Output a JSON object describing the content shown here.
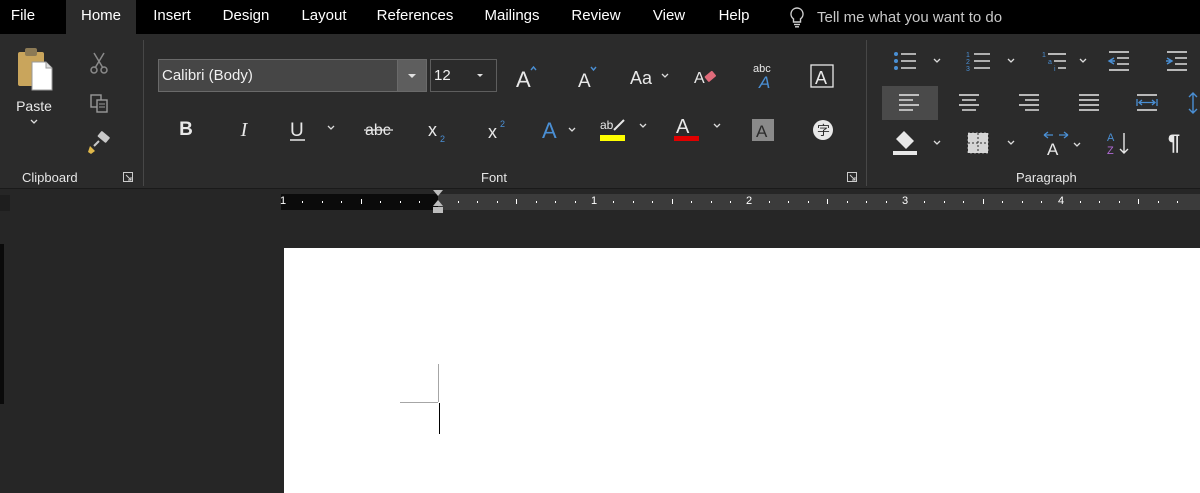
{
  "tabs": [
    {
      "label": "File",
      "active": false
    },
    {
      "label": "Home",
      "active": true
    },
    {
      "label": "Insert",
      "active": false
    },
    {
      "label": "Design",
      "active": false
    },
    {
      "label": "Layout",
      "active": false
    },
    {
      "label": "References",
      "active": false
    },
    {
      "label": "Mailings",
      "active": false
    },
    {
      "label": "Review",
      "active": false
    },
    {
      "label": "View",
      "active": false
    },
    {
      "label": "Help",
      "active": false
    }
  ],
  "tell_me": {
    "placeholder": "Tell me what you want to do",
    "icon": "lightbulb-icon"
  },
  "clipboard": {
    "paste_label": "Paste",
    "group_label": "Clipboard"
  },
  "font": {
    "group_label": "Font",
    "font_name": "Calibri (Body)",
    "font_size": "12"
  },
  "paragraph": {
    "group_label": "Paragraph"
  },
  "ruler": {
    "labels": [
      "1",
      "1",
      "2",
      "3",
      "4"
    ]
  },
  "colors": {
    "tab_bar": "#000000",
    "ribbon": "#2b2b2b",
    "highlight": "#ffff00",
    "font_color": "#e00000",
    "accent_blue": "#4a8fd4",
    "page": "#ffffff"
  }
}
